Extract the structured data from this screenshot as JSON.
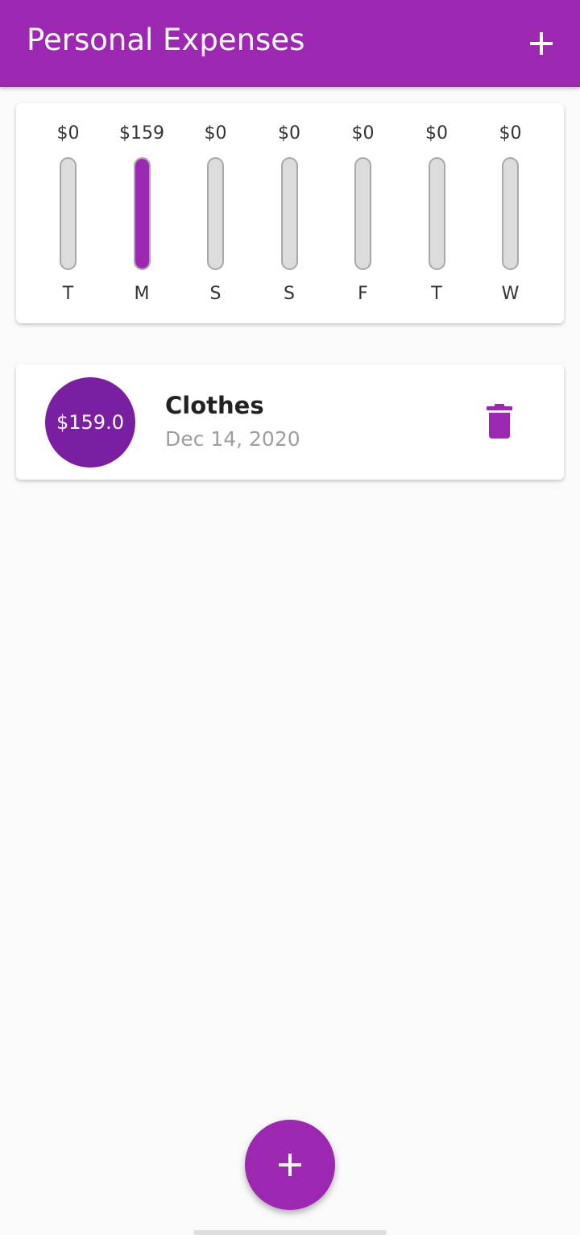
{
  "appbar": {
    "title": "Personal Expenses",
    "add_icon": "plus-icon"
  },
  "chart_data": {
    "type": "bar",
    "categories": [
      "T",
      "M",
      "S",
      "S",
      "F",
      "T",
      "W"
    ],
    "amount_labels": [
      "$0",
      "$159",
      "$0",
      "$0",
      "$0",
      "$0",
      "$0"
    ],
    "values": [
      0,
      159,
      0,
      0,
      0,
      0,
      0
    ],
    "fill_fraction": [
      0,
      1,
      0,
      0,
      0,
      0,
      0
    ],
    "bar_color": "#9c27b0",
    "track_color": "#dcdcdc"
  },
  "transactions": [
    {
      "amount": "$159.0",
      "title": "Clothes",
      "date": "Dec 14, 2020",
      "delete_icon": "trash-icon"
    }
  ],
  "fab": {
    "icon": "plus-icon"
  },
  "colors": {
    "primary": "#9c27b0",
    "avatar": "#7b1fa2",
    "background": "#fafafa"
  }
}
